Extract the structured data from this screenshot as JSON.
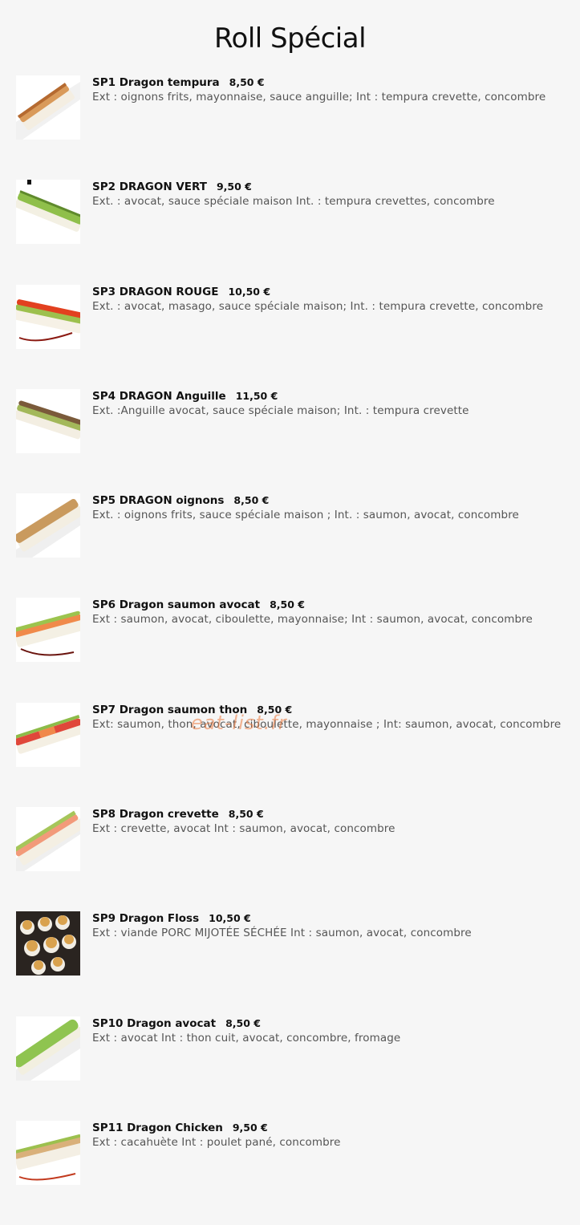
{
  "page": {
    "title": "Roll Spécial"
  },
  "watermark": "eat-list.fr",
  "items": [
    {
      "code_name": "SP1 Dragon tempura",
      "price": "8,50 €",
      "desc": "Ext : oignons frits, mayonnaise, sauce anguille; Int : tempura crevette, concombre"
    },
    {
      "code_name": "SP2 DRAGON VERT",
      "price": "9,50 €",
      "desc": "Ext. : avocat, sauce spéciale maison Int. : tempura crevettes, concombre"
    },
    {
      "code_name": "SP3 DRAGON ROUGE",
      "price": "10,50 €",
      "desc": "Ext. : avocat, masago, sauce spéciale maison; Int. : tempura crevette, concombre"
    },
    {
      "code_name": "SP4 DRAGON Anguille",
      "price": "11,50 €",
      "desc": "Ext. :Anguille avocat, sauce spéciale maison; Int. : tempura crevette"
    },
    {
      "code_name": "SP5 DRAGON oignons",
      "price": "8,50 €",
      "desc": "Ext. : oignons frits, sauce spéciale maison ; Int. : saumon, avocat, concombre"
    },
    {
      "code_name": "SP6 Dragon saumon avocat",
      "price": "8,50 €",
      "desc": "Ext : saumon, avocat, ciboulette, mayonnaise; Int : saumon, avocat, concombre"
    },
    {
      "code_name": "SP7 Dragon saumon thon",
      "price": "8,50 €",
      "desc": "Ext: saumon, thon, avocat, ciboulette, mayonnaise ; Int: saumon, avocat, concombre"
    },
    {
      "code_name": "SP8 Dragon crevette",
      "price": "8,50 €",
      "desc": "Ext : crevette, avocat Int : saumon, avocat, concombre"
    },
    {
      "code_name": "SP9 Dragon Floss",
      "price": "10,50 €",
      "desc": "Ext : viande PORC MIJOTÉE SÉCHÉE Int : saumon, avocat, concombre"
    },
    {
      "code_name": "SP10 Dragon avocat",
      "price": "8,50 €",
      "desc": "Ext : avocat Int : thon cuit, avocat, concombre, fromage"
    },
    {
      "code_name": "SP11 Dragon Chicken",
      "price": "9,50 €",
      "desc": "Ext : cacahuète Int : poulet pané, concombre"
    }
  ]
}
